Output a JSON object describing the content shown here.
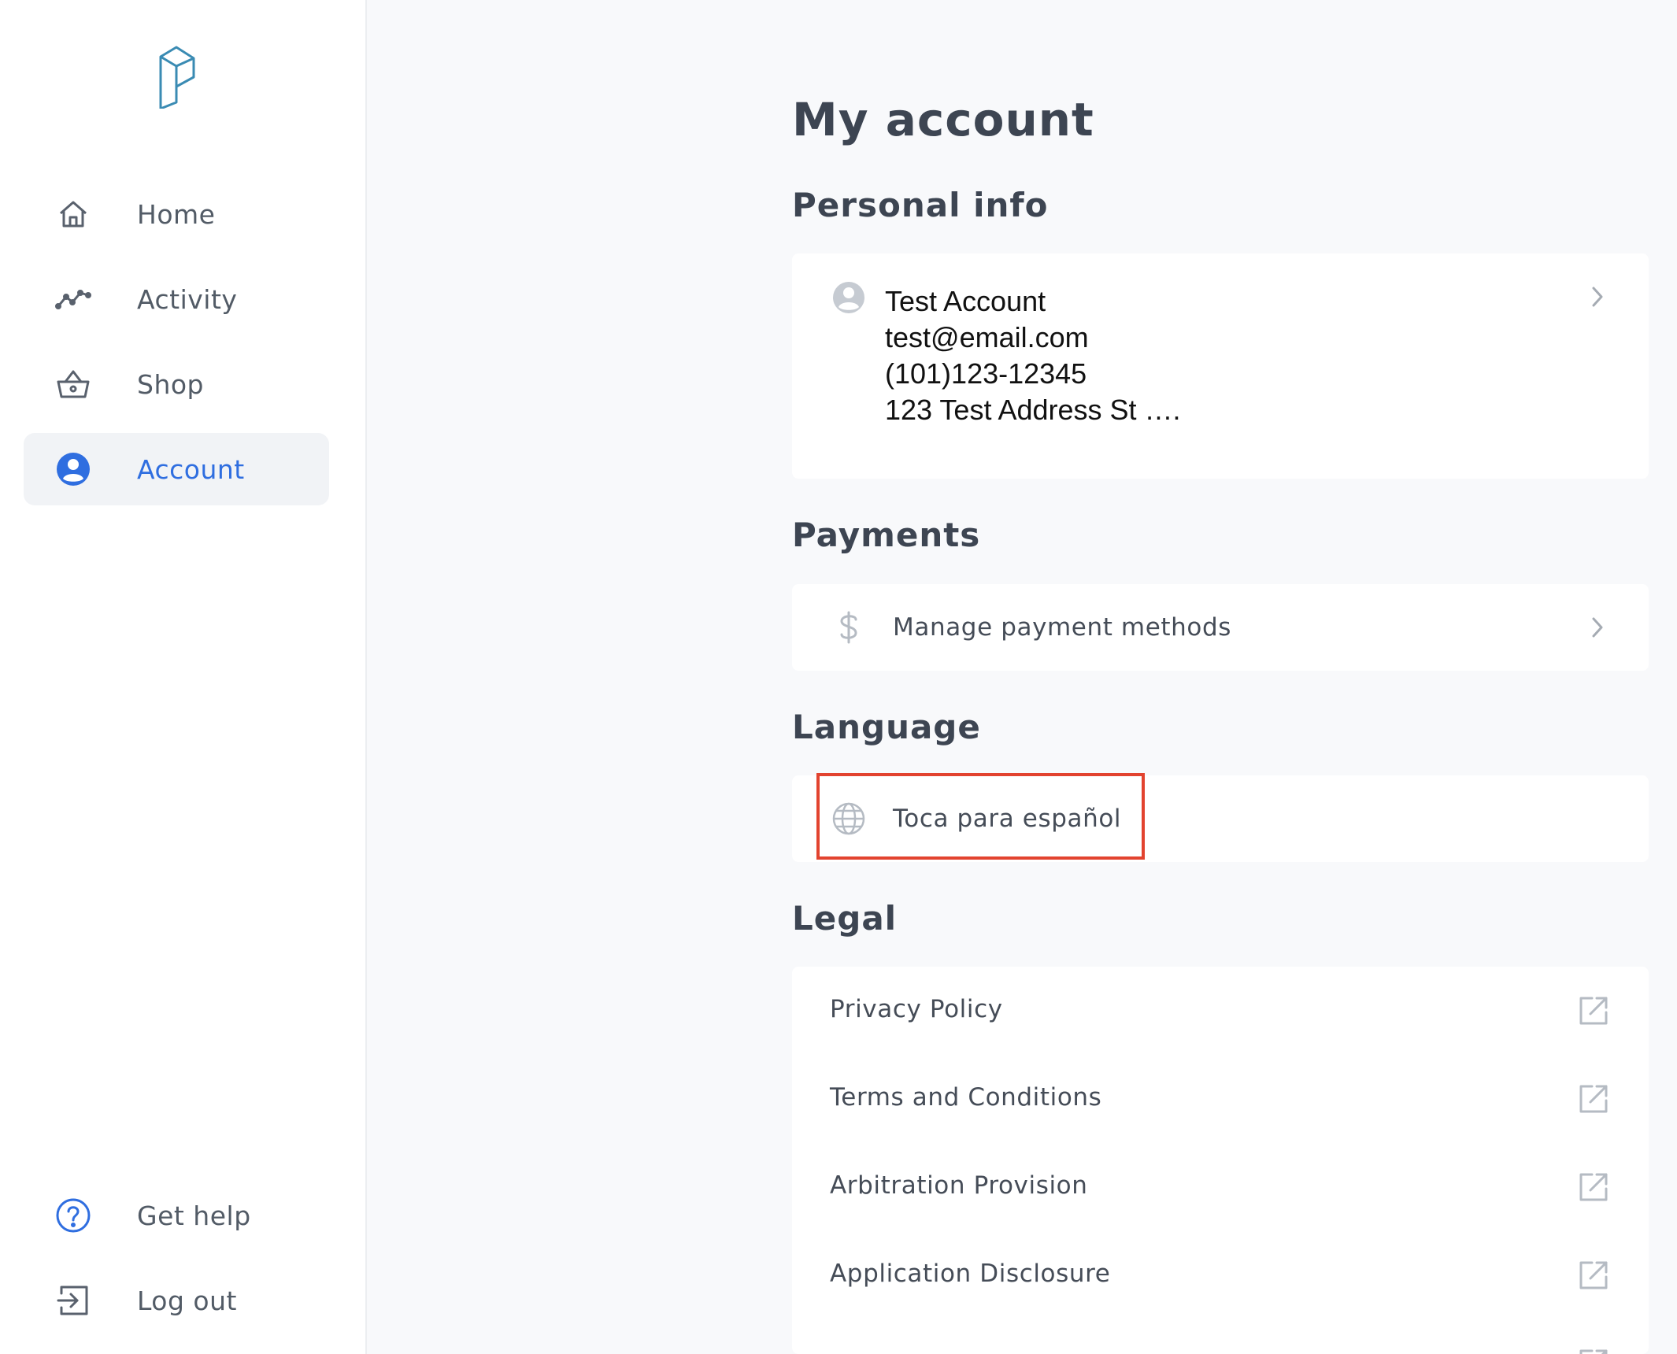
{
  "sidebar": {
    "logo_icon": "brand-logo-icon",
    "nav": [
      {
        "label": "Home",
        "icon": "home-icon",
        "active": false
      },
      {
        "label": "Activity",
        "icon": "activity-icon",
        "active": false
      },
      {
        "label": "Shop",
        "icon": "basket-icon",
        "active": false
      },
      {
        "label": "Account",
        "icon": "user-circle-icon",
        "active": true
      }
    ],
    "bottom": [
      {
        "label": "Get help",
        "icon": "help-icon"
      },
      {
        "label": "Log out",
        "icon": "logout-icon"
      }
    ]
  },
  "main": {
    "title": "My account",
    "personal": {
      "heading": "Personal info",
      "name": "Test Account",
      "email": "test@email.com",
      "phone": "(101)123-12345",
      "address": "123 Test Address St …."
    },
    "payments": {
      "heading": "Payments",
      "label": "Manage payment methods"
    },
    "language": {
      "heading": "Language",
      "label": "Toca para español"
    },
    "legal": {
      "heading": "Legal",
      "items": [
        "Privacy Policy",
        "Terms and Conditions",
        "Arbitration Provision",
        "Application Disclosure"
      ]
    }
  },
  "colors": {
    "accent": "#2f6ee0",
    "highlight": "#e2432f",
    "background": "#f8f9fb"
  }
}
